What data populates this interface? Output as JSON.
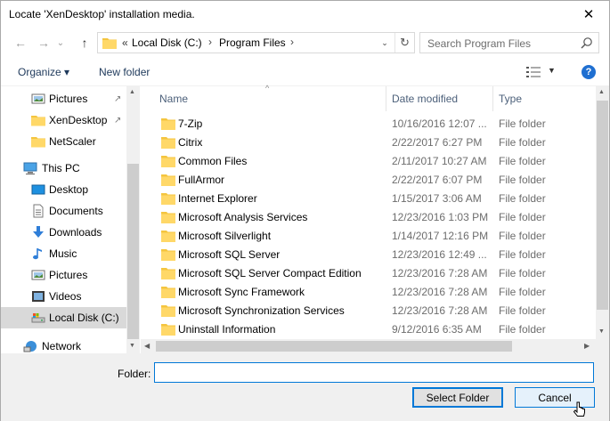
{
  "window": {
    "title": "Locate 'XenDesktop' installation media.",
    "close_glyph": "✕"
  },
  "nav": {
    "back_glyph": "←",
    "forward_glyph": "→",
    "recent_glyph": "⌄",
    "up_glyph": "↑"
  },
  "address": {
    "overflow": "«",
    "crumbs": [
      "Local Disk (C:)",
      "Program Files"
    ],
    "chevron": "›",
    "dropdown_glyph": "⌄",
    "refresh_glyph": "↻"
  },
  "search": {
    "placeholder": "Search Program Files"
  },
  "toolbar": {
    "organize_label": "Organize ▾",
    "new_folder_label": "New folder",
    "view_dd_glyph": "▼",
    "help_label": "?"
  },
  "navpane": {
    "quick_items": [
      {
        "label": "Pictures",
        "icon": "pictures-icon",
        "pinned": true
      },
      {
        "label": "XenDesktop",
        "icon": "folder-icon",
        "pinned": true
      },
      {
        "label": "NetScaler",
        "icon": "folder-icon",
        "pinned": false
      }
    ],
    "this_pc_label": "This PC",
    "pc_items": [
      {
        "label": "Desktop",
        "icon": "desktop-icon"
      },
      {
        "label": "Documents",
        "icon": "documents-icon"
      },
      {
        "label": "Downloads",
        "icon": "downloads-icon"
      },
      {
        "label": "Music",
        "icon": "music-icon"
      },
      {
        "label": "Pictures",
        "icon": "pictures-icon"
      },
      {
        "label": "Videos",
        "icon": "videos-icon"
      },
      {
        "label": "Local Disk (C:)",
        "icon": "drive-icon",
        "selected": true
      }
    ],
    "network_label": "Network",
    "pin_glyph": "📌"
  },
  "columns": {
    "name": "Name",
    "date": "Date modified",
    "type": "Type",
    "sort_glyph": "^"
  },
  "files": [
    {
      "name": "7-Zip",
      "date": "10/16/2016 12:07 ...",
      "type": "File folder"
    },
    {
      "name": "Citrix",
      "date": "2/22/2017 6:27 PM",
      "type": "File folder"
    },
    {
      "name": "Common Files",
      "date": "2/11/2017 10:27 AM",
      "type": "File folder"
    },
    {
      "name": "FullArmor",
      "date": "2/22/2017 6:07 PM",
      "type": "File folder"
    },
    {
      "name": "Internet Explorer",
      "date": "1/15/2017 3:06 AM",
      "type": "File folder"
    },
    {
      "name": "Microsoft Analysis Services",
      "date": "12/23/2016 1:03 PM",
      "type": "File folder"
    },
    {
      "name": "Microsoft Silverlight",
      "date": "1/14/2017 12:16 PM",
      "type": "File folder"
    },
    {
      "name": "Microsoft SQL Server",
      "date": "12/23/2016 12:49 ...",
      "type": "File folder"
    },
    {
      "name": "Microsoft SQL Server Compact Edition",
      "date": "12/23/2016 7:28 AM",
      "type": "File folder"
    },
    {
      "name": "Microsoft Sync Framework",
      "date": "12/23/2016 7:28 AM",
      "type": "File folder"
    },
    {
      "name": "Microsoft Synchronization Services",
      "date": "12/23/2016 7:28 AM",
      "type": "File folder"
    },
    {
      "name": "Uninstall Information",
      "date": "9/12/2016 6:35 AM",
      "type": "File folder"
    }
  ],
  "footer": {
    "folder_label": "Folder:",
    "folder_value": "",
    "select_label": "Select Folder",
    "cancel_label": "Cancel"
  },
  "colors": {
    "folder_yellow": "#f4c53f",
    "accent_blue": "#0078d7",
    "selected_bg": "#d9d9d9"
  }
}
